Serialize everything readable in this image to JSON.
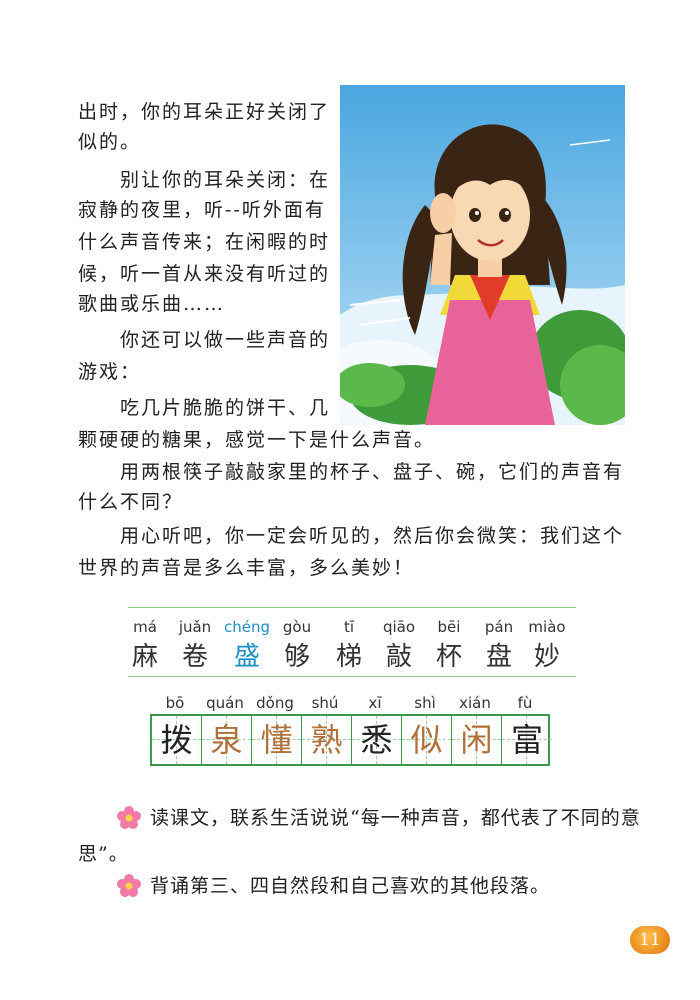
{
  "text": {
    "l1": "出时，你的耳朵正好关闭了",
    "l2": "似的。",
    "l3": "别让你的耳朵关闭：在",
    "l4": "寂静的夜里，听--听外面有",
    "l5": "什么声音传来；在闲暇的时",
    "l6": "候，听一首从来没有听过的",
    "l7": "歌曲或乐曲……",
    "l8": "你还可以做一些声音的",
    "l9": "游戏：",
    "l10": "吃几片脆脆的饼干、几",
    "l11": "颗硬硬的糖果，感觉一下是什么声音。",
    "l12": "用两根筷子敲敲家里的杯子、盘子、碗，它们的声音有",
    "l13": "什么不同？",
    "l14": "用心听吧，你一定会听见的，然后你会微笑：我们这个",
    "l15": "世界的声音是多么丰富，多么美妙！"
  },
  "vocab_read": {
    "pinyin": [
      "má",
      "juǎn",
      "chéng",
      "gòu",
      "tī",
      "qiāo",
      "bēi",
      "pán",
      "miào"
    ],
    "chars": [
      "麻",
      "卷",
      "盛",
      "够",
      "梯",
      "敲",
      "杯",
      "盘",
      "妙"
    ]
  },
  "vocab_write": {
    "pinyin": [
      "bō",
      "quán",
      "dǒng",
      "shú",
      "xī",
      "shì",
      "xián",
      "fù"
    ],
    "chars": [
      "拨",
      "泉",
      "懂",
      "熟",
      "悉",
      "似",
      "闲",
      "富"
    ]
  },
  "exercises": {
    "q1a": "读课文，联系生活说说“每一种声音，都代表了不同的意",
    "q1b": "思”。",
    "q2": "背诵第三、四自然段和自己喜欢的其他段落。"
  },
  "page_number": "11",
  "colors": {
    "accent_green": "#3a9a4a",
    "pinyin_blue": "#1e90c8",
    "char_brown": "#b0703a",
    "badge_orange": "#e88a1c"
  },
  "icons": {
    "exercise_marker": "pink-flower-icon"
  }
}
